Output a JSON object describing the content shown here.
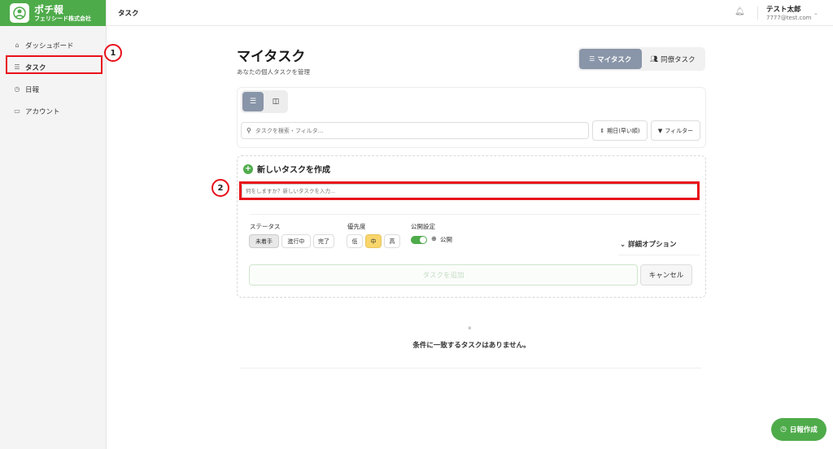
{
  "brand": {
    "name": "ポチ報",
    "company": "フェリシード株式会社"
  },
  "sidebar": {
    "items": [
      {
        "label": "ダッシュボード",
        "icon": "home-icon"
      },
      {
        "label": "タスク",
        "icon": "list-icon"
      },
      {
        "label": "日報",
        "icon": "clock-icon"
      },
      {
        "label": "アカウント",
        "icon": "card-icon"
      }
    ]
  },
  "topbar": {
    "title": "タスク",
    "user_name": "テスト太郎",
    "user_email": "7777@test.com"
  },
  "main": {
    "title": "マイタスク",
    "subtitle": "あなたの個人タスクを管理",
    "view_switch": {
      "mine": "マイタスク",
      "colleague": "同僚タスク"
    },
    "search_placeholder": "タスクを検索・フィルタ...",
    "sort_label": "期日(早い順)",
    "filter_label": "フィルター",
    "create": {
      "heading": "新しいタスクを作成",
      "input_placeholder": "何をしますか？新しいタスクを入力...",
      "status_label": "ステータス",
      "status_options": [
        "未着手",
        "進行中",
        "完了"
      ],
      "priority_label": "優先度",
      "priority_options": [
        "低",
        "中",
        "高"
      ],
      "visibility_label": "公開設定",
      "visibility_value": "公開",
      "advanced_label": "詳細オプション",
      "add_label": "タスクを追加",
      "cancel_label": "キャンセル"
    },
    "empty_text": "条件に一致するタスクはありません。"
  },
  "annotations": {
    "marker1": "1",
    "marker2": "2"
  },
  "fab_label": "日報作成",
  "colors": {
    "brand": "#4eab4a",
    "highlight": "#e8101a",
    "active": "#8995a8"
  }
}
